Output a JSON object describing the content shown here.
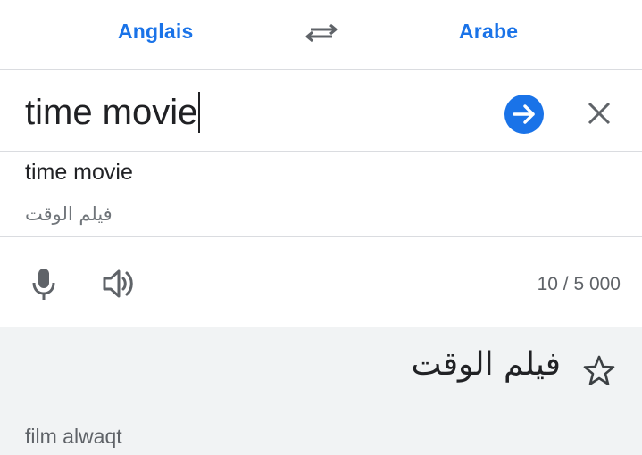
{
  "language_bar": {
    "source_language": "Anglais",
    "target_language": "Arabe",
    "swap_icon": "swap-arrows-icon"
  },
  "input": {
    "value": "time movie",
    "go_icon": "arrow-forward-circle-icon",
    "clear_icon": "close-icon"
  },
  "suggestion": {
    "source_text": "time movie",
    "translation": "فيلم الوقت"
  },
  "tools": {
    "mic_icon": "microphone-icon",
    "speaker_icon": "speaker-icon",
    "char_count": "10 / 5 000"
  },
  "result": {
    "translation": "فيلم الوقت",
    "transliteration": "film alwaqt",
    "star_icon": "star-outline-icon"
  },
  "colors": {
    "accent": "#1a73e8",
    "result_background": "#f1f3f4",
    "text_primary": "#202124",
    "text_secondary": "#5f6368"
  }
}
